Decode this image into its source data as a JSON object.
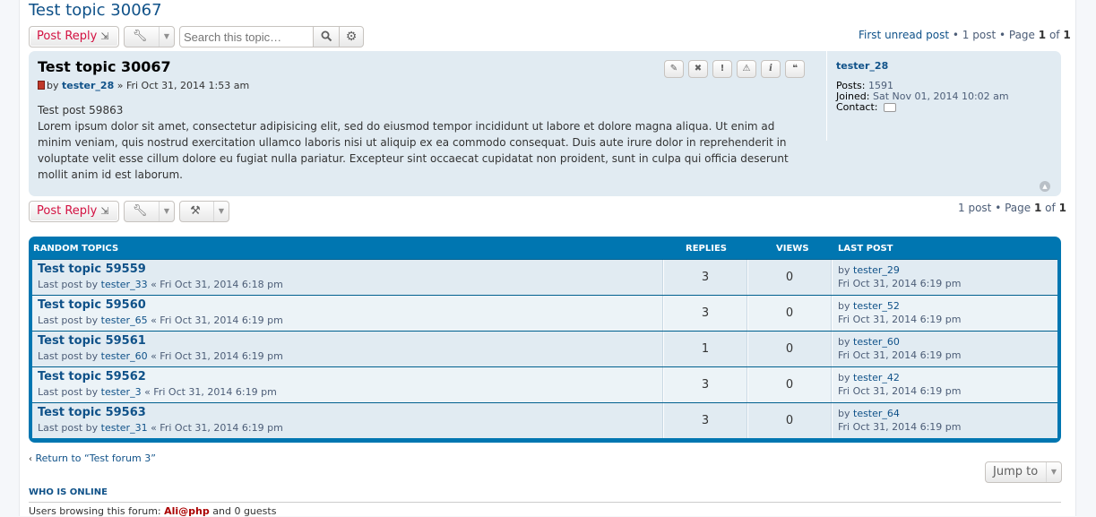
{
  "topic": {
    "title": "Test topic 30067"
  },
  "actions": {
    "post_reply_label": "Post Reply",
    "search_placeholder": "Search this topic…"
  },
  "pagination_top": {
    "first_unread": "First unread post",
    "count": "1 post",
    "page_label": "Page",
    "current": "1",
    "of_label": "of",
    "total": "1"
  },
  "pagination_bottom": {
    "count": "1 post",
    "page_label": "Page",
    "current": "1",
    "of_label": "of",
    "total": "1"
  },
  "post": {
    "title": "Test topic 30067",
    "by_label": "by",
    "author": "tester_28",
    "date": "» Fri Oct 31, 2014 1:53 am",
    "body_line1": "Test post 59863",
    "body_line2": "Lorem ipsum dolor sit amet, consectetur adipisicing elit, sed do eiusmod tempor incididunt ut labore et dolore magna aliqua. Ut enim ad minim veniam, quis nostrud exercitation ullamco laboris nisi ut aliquip ex ea commodo consequat. Duis aute irure dolor in reprehenderit in voluptate velit esse cillum dolore eu fugiat nulla pariatur. Excepteur sint occaecat cupidatat non proident, sunt in culpa qui officia deserunt mollit anim id est laborum.",
    "tools": {
      "edit": "✎",
      "delete": "✖",
      "report": "!",
      "warn": "⚠",
      "info": "i",
      "quote": "❝"
    }
  },
  "profile": {
    "username": "tester_28",
    "posts_label": "Posts:",
    "posts": "1591",
    "joined_label": "Joined:",
    "joined": "Sat Nov 01, 2014 10:02 am",
    "contact_label": "Contact:"
  },
  "random_topics": {
    "headers": {
      "topics": "Random Topics",
      "replies": "Replies",
      "views": "Views",
      "last_post": "Last Post"
    },
    "rows": [
      {
        "title": "Test topic 59559",
        "last_by_label": "Last post by",
        "last_user": "tester_33",
        "last_date": "« Fri Oct 31, 2014 6:18 pm",
        "replies": "3",
        "views": "0",
        "lp_by": "by",
        "lp_user": "tester_29",
        "lp_date": "Fri Oct 31, 2014 6:19 pm"
      },
      {
        "title": "Test topic 59560",
        "last_by_label": "Last post by",
        "last_user": "tester_65",
        "last_date": "« Fri Oct 31, 2014 6:19 pm",
        "replies": "3",
        "views": "0",
        "lp_by": "by",
        "lp_user": "tester_52",
        "lp_date": "Fri Oct 31, 2014 6:19 pm"
      },
      {
        "title": "Test topic 59561",
        "last_by_label": "Last post by",
        "last_user": "tester_60",
        "last_date": "« Fri Oct 31, 2014 6:19 pm",
        "replies": "1",
        "views": "0",
        "lp_by": "by",
        "lp_user": "tester_60",
        "lp_date": "Fri Oct 31, 2014 6:19 pm"
      },
      {
        "title": "Test topic 59562",
        "last_by_label": "Last post by",
        "last_user": "tester_3",
        "last_date": "« Fri Oct 31, 2014 6:19 pm",
        "replies": "3",
        "views": "0",
        "lp_by": "by",
        "lp_user": "tester_42",
        "lp_date": "Fri Oct 31, 2014 6:19 pm"
      },
      {
        "title": "Test topic 59563",
        "last_by_label": "Last post by",
        "last_user": "tester_31",
        "last_date": "« Fri Oct 31, 2014 6:19 pm",
        "replies": "3",
        "views": "0",
        "lp_by": "by",
        "lp_user": "tester_64",
        "lp_date": "Fri Oct 31, 2014 6:19 pm"
      }
    ]
  },
  "footer": {
    "return_link": "Return to “Test forum 3”",
    "jump_to": "Jump to",
    "who_is_online": "Who is online",
    "browsing_prefix": "Users browsing this forum:",
    "browsing_user": "Ali@php",
    "browsing_suffix": "and 0 guests"
  },
  "colors": {
    "link": "#105289",
    "accent_red": "#d31141",
    "post_bg": "#e1ebf2",
    "table_header": "#0076b1"
  },
  "icons": [
    "reply-arrow-icon",
    "wrench-icon",
    "search-icon",
    "gear-icon",
    "hammer-icon",
    "chevron-down-icon",
    "pencil-icon",
    "close-icon",
    "exclamation-icon",
    "warning-icon",
    "info-icon",
    "quote-icon",
    "post-icon",
    "contact-bubble-icon",
    "back-to-top-icon",
    "chevron-left-icon"
  ]
}
